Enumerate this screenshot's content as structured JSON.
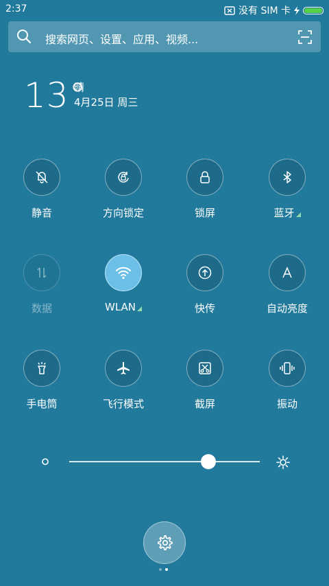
{
  "status_bar": {
    "time": "2:37",
    "sim": "没有 SIM 卡",
    "battery_level": 1.0,
    "battery_color": "#55d24a"
  },
  "search": {
    "placeholder": "搜索网页、设置、应用、视频..."
  },
  "weather": {
    "temp": "13°",
    "condition": "晴",
    "date": "4月25日 周三"
  },
  "tiles": [
    {
      "label": "静音",
      "icon": "bell-off-icon",
      "state": "off"
    },
    {
      "label": "方向锁定",
      "icon": "rotation-lock-icon",
      "state": "off"
    },
    {
      "label": "锁屏",
      "icon": "lock-icon",
      "state": "off"
    },
    {
      "label": "蓝牙",
      "icon": "bluetooth-icon",
      "state": "off",
      "has_more": true
    },
    {
      "label": "数据",
      "icon": "mobile-data-icon",
      "state": "disabled"
    },
    {
      "label": "WLAN",
      "icon": "wifi-icon",
      "state": "on",
      "has_more": true
    },
    {
      "label": "快传",
      "icon": "quick-transfer-icon",
      "state": "off"
    },
    {
      "label": "自动亮度",
      "icon": "auto-brightness-icon",
      "state": "off"
    },
    {
      "label": "手电筒",
      "icon": "flashlight-icon",
      "state": "off"
    },
    {
      "label": "飞行模式",
      "icon": "airplane-icon",
      "state": "off"
    },
    {
      "label": "截屏",
      "icon": "screenshot-icon",
      "state": "off"
    },
    {
      "label": "振动",
      "icon": "vibrate-icon",
      "state": "off"
    }
  ],
  "brightness": {
    "level": 0.73
  },
  "colors": {
    "background": "#217a9c",
    "active": "#6cc0e8",
    "more_indicator": "#8fd9ad"
  },
  "pager": {
    "pages": 2,
    "current": 2
  }
}
